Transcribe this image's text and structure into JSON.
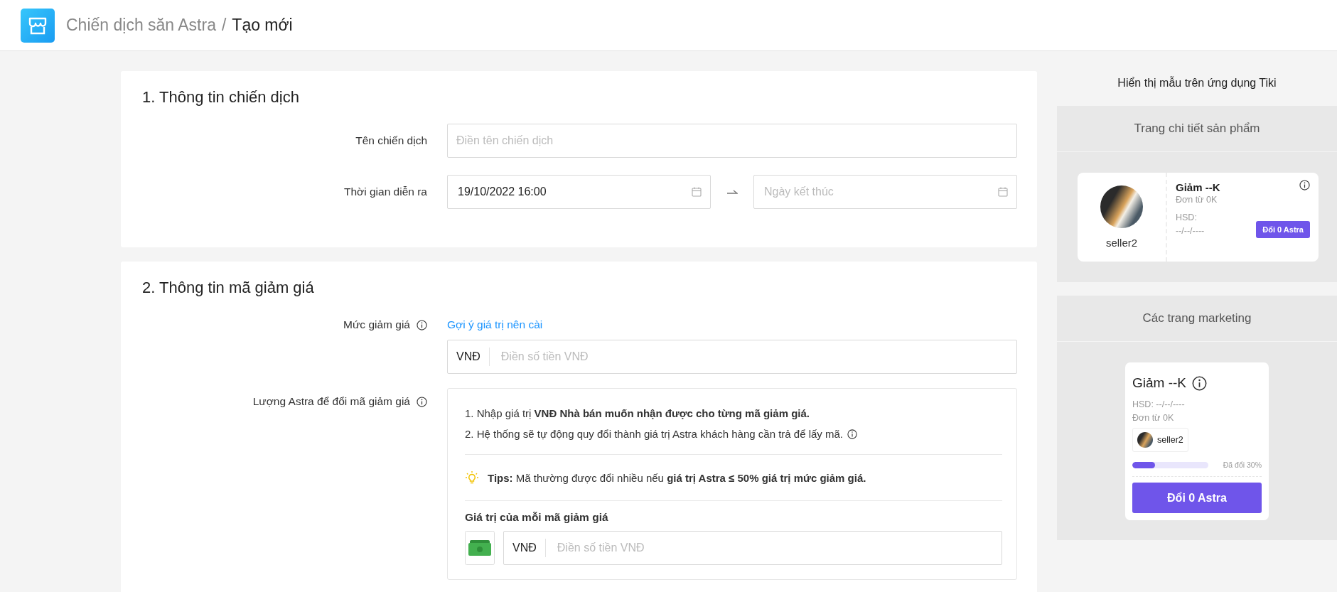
{
  "header": {
    "breadcrumb_parent": "Chiến dịch săn Astra",
    "separator": "/",
    "breadcrumb_current": "Tạo mới"
  },
  "campaign_section": {
    "title": "1. Thông tin chiến dịch",
    "name_field": {
      "label": "Tên chiến dịch",
      "placeholder": "Điền tên chiến dịch"
    },
    "time_field": {
      "label": "Thời gian diễn ra",
      "start_value": "19/10/2022 16:00",
      "end_placeholder": "Ngày kết thúc"
    }
  },
  "discount_section": {
    "title": "2. Thông tin mã giảm giá",
    "discount_level": {
      "label": "Mức giảm giá",
      "suggestion_link": "Gợi ý giá trị nên cài",
      "currency": "VNĐ",
      "placeholder": "Điền số tiền VNĐ"
    },
    "astra_amount": {
      "label": "Lượng Astra để đổi mã giảm giá",
      "instructions": [
        "1. Nhập giá trị **VNĐ Nhà bán muốn nhận được cho từng mã giảm giá.**",
        "2. Hệ thống sẽ tự động quy đổi thành giá trị Astra khách hàng cần trả để lấy mã."
      ],
      "tip": "**Tips:** Mã thường được đổi nhiều nếu **giá trị Astra ≤ 50% giá trị mức giảm giá.**",
      "value_label": "Giá trị của mỗi mã giảm giá",
      "currency": "VNĐ",
      "placeholder": "Điền số tiền VNĐ"
    }
  },
  "preview": {
    "title": "Hiển thị mẫu trên ứng dụng Tiki",
    "panels": [
      {
        "kind": "product",
        "title": "Trang chi tiết sản phẩm",
        "voucher": {
          "seller": "seller2",
          "title": "Giảm --K",
          "min_order": "Đơn từ 0K",
          "expiry_label": "HSD:",
          "expiry_value": "--/--/----",
          "button": "Đổi 0 Astra"
        }
      },
      {
        "kind": "marketing",
        "title": "Các trang marketing",
        "voucher": {
          "title": "Giảm --K",
          "expiry": "HSD: --/--/----",
          "min_order": "Đơn từ 0K",
          "seller": "seller2",
          "redeemed": "Đã đổi 30%",
          "level": 0.3,
          "button": "Đổi 0 Astra"
        }
      }
    ]
  }
}
